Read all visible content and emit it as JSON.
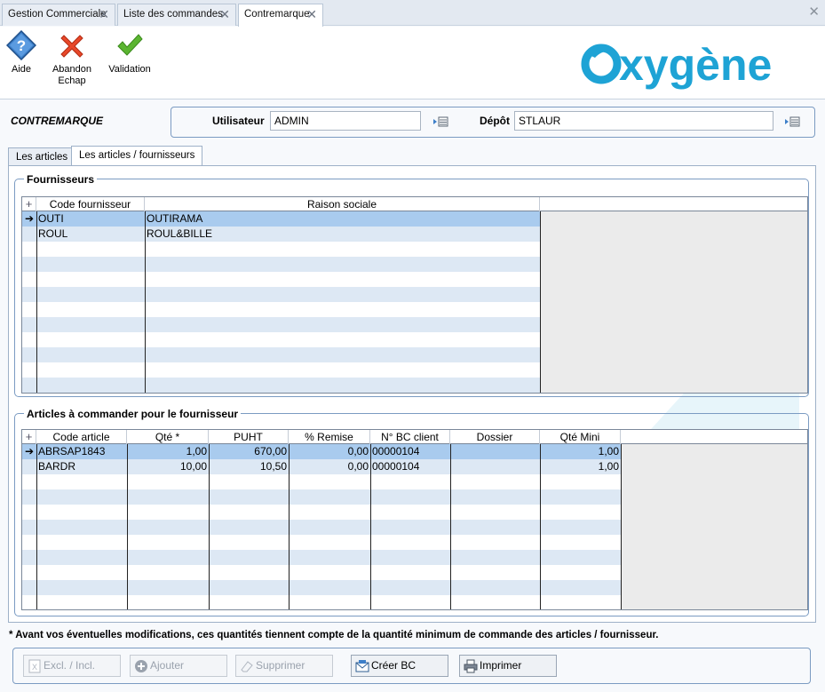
{
  "tabs": [
    {
      "label": "Gestion Commerciale"
    },
    {
      "label": "Liste des commandes"
    },
    {
      "label": "Contremarque"
    }
  ],
  "toolbar": {
    "aide": "Aide",
    "abandon": "Abandon",
    "abandon_sub": "Echap",
    "validation": "Validation"
  },
  "logo": {
    "text": "xygène",
    "accent": "#1ea3d5"
  },
  "header": {
    "title": "CONTREMARQUE",
    "utilisateur_label": "Utilisateur",
    "utilisateur_value": "ADMIN",
    "depot_label": "Dépôt",
    "depot_value": "STLAUR"
  },
  "subtabs": [
    {
      "label": "Les articles"
    },
    {
      "label": "Les articles / fournisseurs"
    }
  ],
  "fournisseurs": {
    "title": "Fournisseurs",
    "columns": [
      "Code fournisseur",
      "Raison sociale"
    ],
    "rows": [
      [
        "OUTI",
        "OUTIRAMA"
      ],
      [
        "ROUL",
        "ROUL&BILLE"
      ]
    ]
  },
  "articles": {
    "title": "Articles à commander pour le fournisseur",
    "columns": [
      "Code article",
      "Qté *",
      "PUHT",
      "% Remise",
      "N° BC client",
      "Dossier",
      "Qté Mini"
    ],
    "rows": [
      [
        "ABRSAP1843",
        "1,00",
        "670,00",
        "0,00",
        "00000104",
        "",
        "1,00"
      ],
      [
        "BARDR",
        "10,00",
        "10,50",
        "0,00",
        "00000104",
        "",
        "1,00"
      ]
    ]
  },
  "note": "* Avant vos éventuelles modifications, ces quantités tiennent compte de la quantité minimum de commande des articles / fournisseur.",
  "buttons": {
    "excl": "Excl. / Incl.",
    "ajouter": "Ajouter",
    "supprimer": "Supprimer",
    "creer_bc": "Créer BC",
    "imprimer": "Imprimer"
  }
}
